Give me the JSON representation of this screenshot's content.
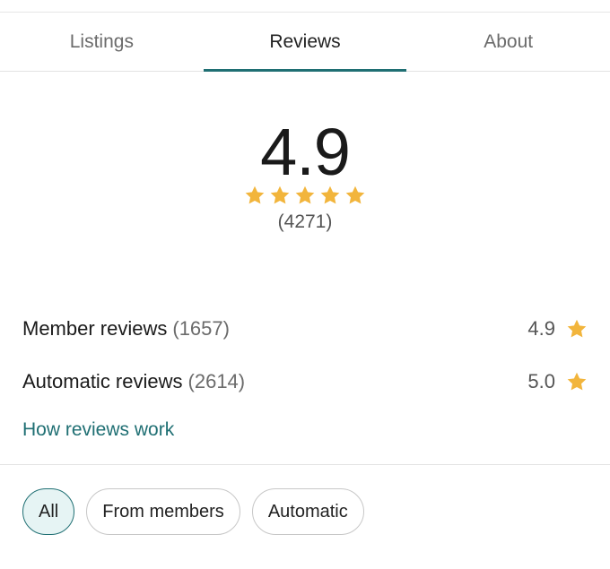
{
  "tabs": [
    {
      "label": "Listings",
      "active": false
    },
    {
      "label": "Reviews",
      "active": true
    },
    {
      "label": "About",
      "active": false
    }
  ],
  "summary": {
    "score": "4.9",
    "stars": 5,
    "count": "(4271)"
  },
  "breakdown": [
    {
      "label": "Member reviews",
      "count": "(1657)",
      "score": "4.9"
    },
    {
      "label": "Automatic reviews",
      "count": "(2614)",
      "score": "5.0"
    }
  ],
  "how_reviews_link": "How reviews work",
  "filters": [
    {
      "label": "All",
      "selected": true
    },
    {
      "label": "From members",
      "selected": false
    },
    {
      "label": "Automatic",
      "selected": false
    }
  ],
  "colors": {
    "accent": "#1f6f73",
    "star": "#f2b53c",
    "chip_selected_bg": "#e6f4f4"
  },
  "icons": {
    "star": "star-icon"
  }
}
